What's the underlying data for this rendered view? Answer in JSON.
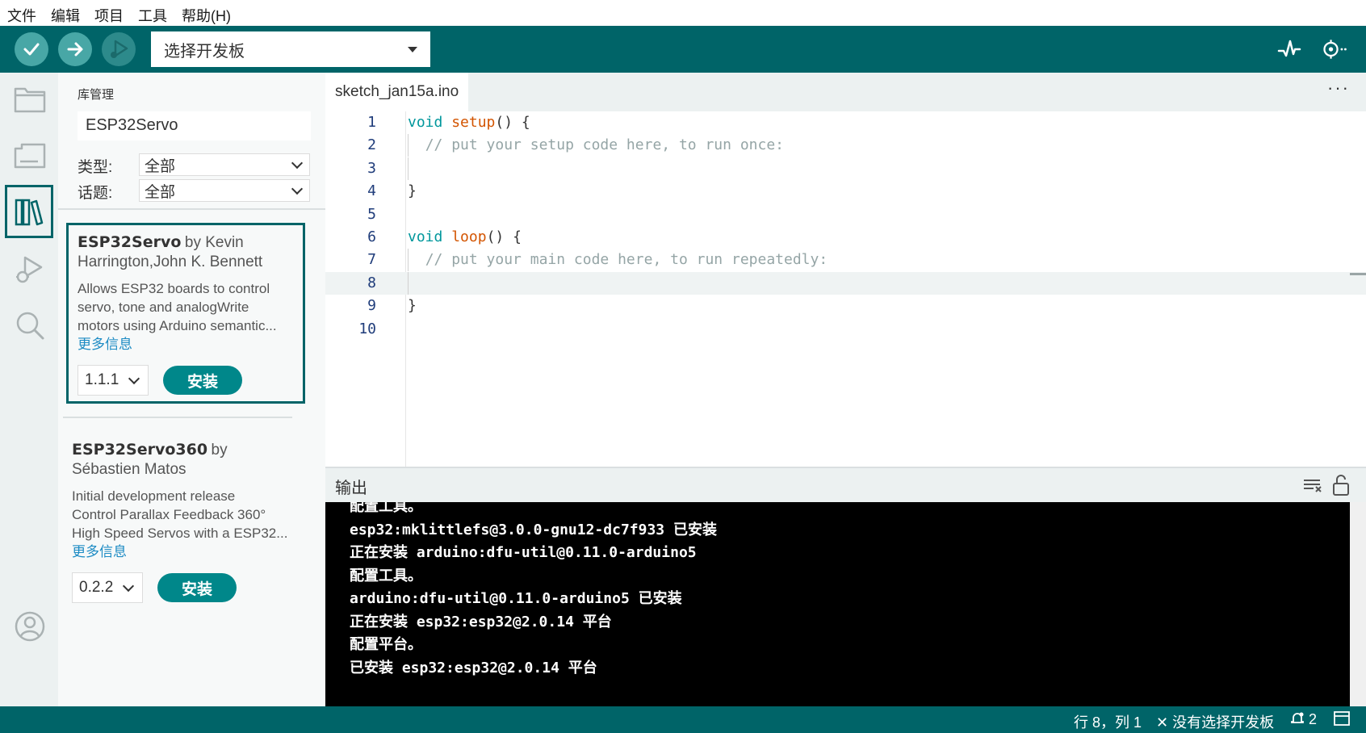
{
  "menu": [
    "文件",
    "编辑",
    "项目",
    "工具",
    "帮助(H)"
  ],
  "toolbar": {
    "verify_icon": "check-icon",
    "upload_icon": "arrow-right-icon",
    "debug_icon": "debug-icon",
    "board_select": "选择开发板",
    "serial_plotter_icon": "pulse-icon",
    "serial_monitor_icon": "magnifier-dots-icon"
  },
  "sidebar": {
    "items": [
      "folder-icon",
      "board-icon",
      "library-icon",
      "debug-icon",
      "search-icon"
    ],
    "profile_icon": "profile-icon",
    "active": "library-icon"
  },
  "library": {
    "title": "库管理",
    "search_value": "ESP32Servo",
    "filter_type_label": "类型:",
    "filter_type_value": "全部",
    "filter_topic_label": "话题:",
    "filter_topic_value": "全部",
    "items": [
      {
        "name": "ESP32Servo",
        "by": "by Kevin",
        "author": "Harrington,John K. Bennett",
        "desc_lines": [
          "Allows ESP32 boards to control",
          "servo, tone and analogWrite",
          "motors using Arduino semantic..."
        ],
        "more": "更多信息",
        "version": "1.1.1",
        "install": "安装"
      },
      {
        "name": "ESP32Servo360",
        "by": "by",
        "author": "Sébastien Matos",
        "desc_lines": [
          "Initial development release",
          "Control Parallax Feedback 360°",
          "High Speed Servos with a ESP32..."
        ],
        "more": "更多信息",
        "version": "0.2.2",
        "install": "安装"
      }
    ]
  },
  "editor": {
    "tab": "sketch_jan15a.ino",
    "more": "···",
    "lines": [
      {
        "n": "1",
        "code": "void setup() {"
      },
      {
        "n": "2",
        "code": "  // put your setup code here, to run once:"
      },
      {
        "n": "3",
        "code": ""
      },
      {
        "n": "4",
        "code": "}"
      },
      {
        "n": "5",
        "code": ""
      },
      {
        "n": "6",
        "code": "void loop() {"
      },
      {
        "n": "7",
        "code": "  // put your main code here, to run repeatedly:"
      },
      {
        "n": "8",
        "code": ""
      },
      {
        "n": "9",
        "code": "}"
      },
      {
        "n": "10",
        "code": ""
      }
    ],
    "current_line": 8
  },
  "output": {
    "title": "输出",
    "lines": [
      "配置工具。",
      "esp32:mklittlefs@3.0.0-gnu12-dc7f933 已安装",
      "正在安装 arduino:dfu-util@0.11.0-arduino5",
      "配置工具。",
      "arduino:dfu-util@0.11.0-arduino5 已安装",
      "正在安装 esp32:esp32@2.0.14 平台",
      "配置平台。",
      "已安装 esp32:esp32@2.0.14 平台"
    ]
  },
  "status": {
    "position": "行 8，列 1",
    "board": "没有选择开发板",
    "notifications": "2"
  }
}
